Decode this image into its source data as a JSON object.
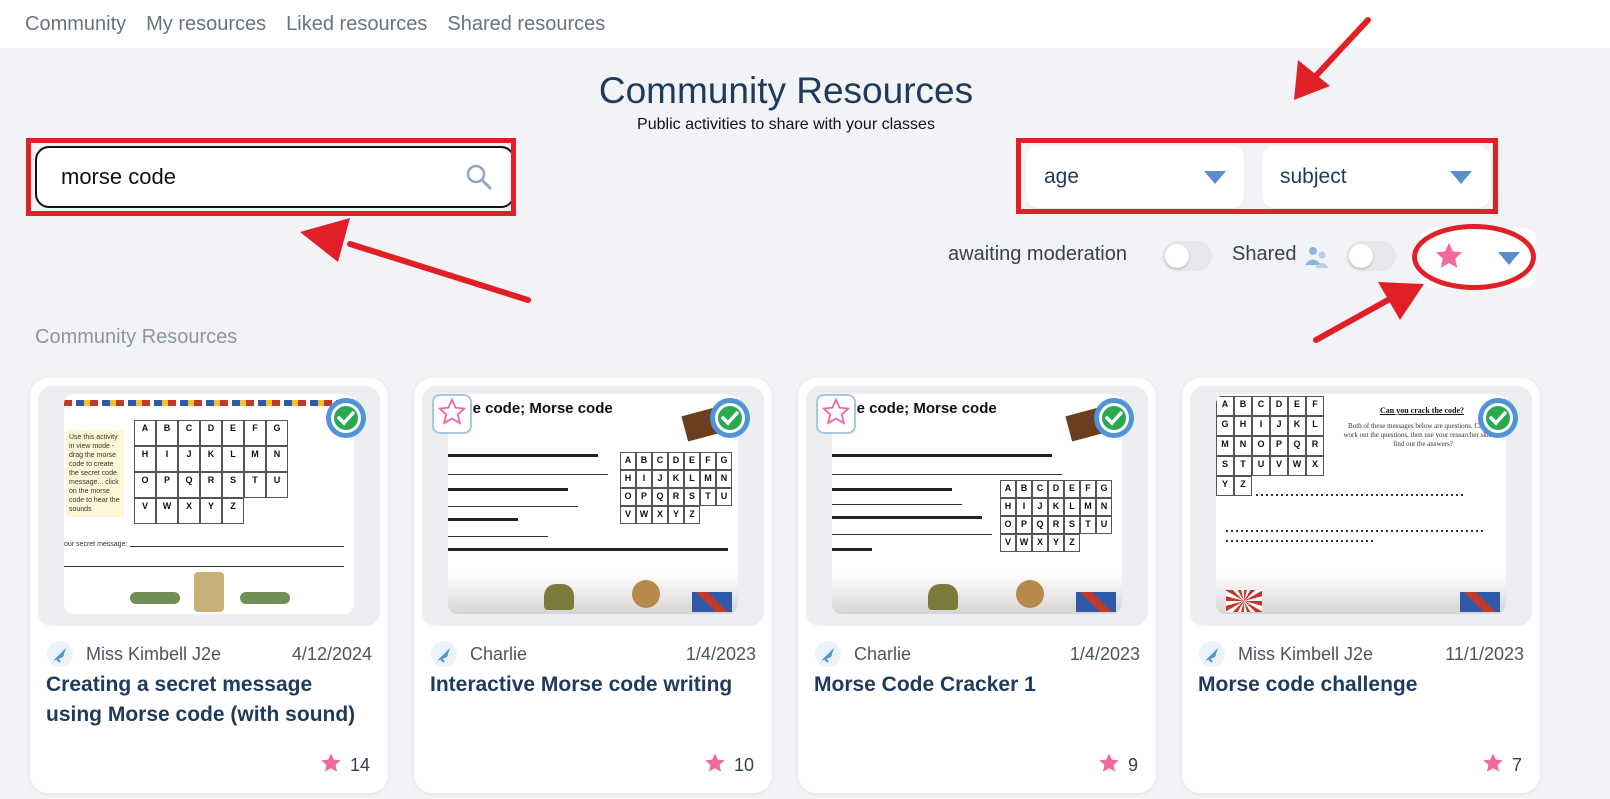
{
  "nav": {
    "items": [
      "Community",
      "My resources",
      "Liked resources",
      "Shared resources"
    ]
  },
  "header": {
    "title": "Community Resources",
    "subtitle": "Public activities to share with your classes"
  },
  "search": {
    "value": "morse code",
    "placeholder": ""
  },
  "filters": {
    "age_label": "age",
    "subject_label": "subject",
    "awaiting_moderation_label": "awaiting moderation",
    "shared_label": "Shared"
  },
  "section": {
    "label": "Community Resources"
  },
  "colors": {
    "accent": "#1e3a5c",
    "annotation": "#e01f26",
    "star": "#f06aa0",
    "caret": "#5b8ec9"
  },
  "cards": [
    {
      "author": "Miss Kimbell J2e",
      "date": "4/12/2024",
      "title": "Creating a secret message using Morse code (with sound)",
      "likes": "14",
      "thumb_text": "Use this activity in view mode - drag the morse code to create the secret code message... click on the morse code to hear the sounds",
      "thumb_label": "our secret message:"
    },
    {
      "author": "Charlie",
      "date": "1/4/2023",
      "title": "Interactive Morse code writing",
      "likes": "10",
      "thumb_heading": "k the code; Morse code"
    },
    {
      "author": "Charlie",
      "date": "1/4/2023",
      "title": "Morse Code Cracker 1",
      "likes": "9",
      "thumb_heading": "k the code; Morse code"
    },
    {
      "author": "Miss Kimbell J2e",
      "date": "11/1/2023",
      "title": "Morse code challenge",
      "likes": "7",
      "thumb_heading": "Can you crack the code?",
      "thumb_text": "Both of these messages below are questions. Can you work out the questions, then use your researcher skills to find out the answers?"
    }
  ],
  "morse_letters": [
    "A",
    "B",
    "C",
    "D",
    "E",
    "F",
    "G",
    "H",
    "I",
    "J",
    "K",
    "L",
    "M",
    "N",
    "O",
    "P",
    "Q",
    "R",
    "S",
    "T",
    "U",
    "V",
    "W",
    "X",
    "Y",
    "Z"
  ]
}
